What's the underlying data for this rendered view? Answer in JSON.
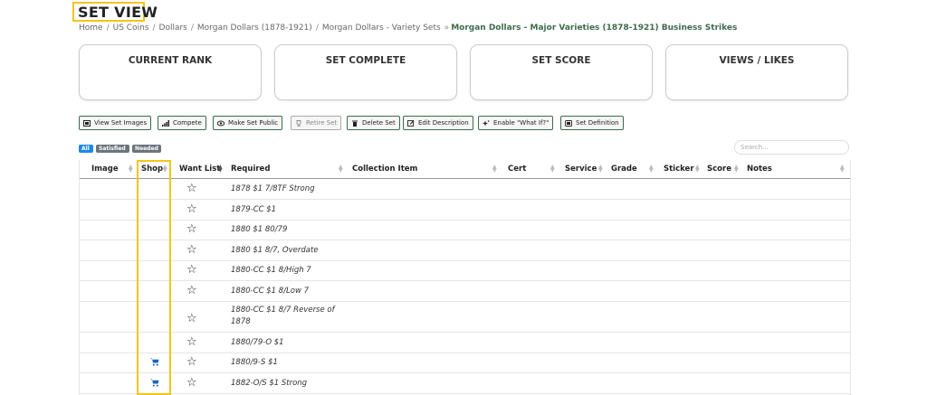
{
  "page": {
    "title": "SET VIEW",
    "breadcrumb": [
      "Home",
      "US Coins",
      "Dollars",
      "Morgan Dollars (1878-1921)",
      "Morgan Dollars - Variety Sets"
    ],
    "breadcrumb_current": "Morgan Dollars - Major Varieties (1878-1921) Business Strikes",
    "breadcrumb_sep": "/",
    "breadcrumb_last_sep": "»"
  },
  "cards": [
    {
      "label": "CURRENT RANK"
    },
    {
      "label": "SET COMPLETE"
    },
    {
      "label": "SET SCORE"
    },
    {
      "label": "VIEWS / LIKES"
    }
  ],
  "toolbar": {
    "buttons": [
      {
        "label": "View Set Images",
        "icon": "image-icon",
        "disabled": false
      },
      {
        "label": "Compete",
        "icon": "bar-chart-icon",
        "disabled": false
      },
      {
        "label": "Make Set Public",
        "icon": "eye-icon",
        "disabled": false
      },
      {
        "label": "Retire Set",
        "icon": "trophy-icon",
        "disabled": true
      },
      {
        "label": "Delete Set",
        "icon": "trash-icon",
        "disabled": false
      },
      {
        "label": "Edit Description",
        "icon": "edit-icon",
        "disabled": false
      },
      {
        "label": "Enable \"What If?\"",
        "icon": "sparkle-icon",
        "disabled": false
      },
      {
        "label": "Set Definition",
        "icon": "definition-icon",
        "disabled": false
      }
    ]
  },
  "filters": [
    {
      "label": "All",
      "color": "#1e88e5"
    },
    {
      "label": "Satisfied",
      "color": "#6c757d"
    },
    {
      "label": "Needed",
      "color": "#6c757d"
    }
  ],
  "search": {
    "placeholder": "Search..."
  },
  "table": {
    "columns": [
      "Image",
      "Shop",
      "Want List",
      "Required",
      "Collection Item",
      "Cert",
      "Service",
      "Grade",
      "Sticker",
      "Score",
      "Notes"
    ],
    "rows": [
      {
        "required": "1878 $1 7/8TF Strong",
        "shop": false
      },
      {
        "required": "1879-CC $1",
        "shop": false
      },
      {
        "required": "1880 $1 80/79",
        "shop": false
      },
      {
        "required": "1880 $1 8/7, Overdate",
        "shop": false
      },
      {
        "required": "1880-CC $1 8/High 7",
        "shop": false
      },
      {
        "required": "1880-CC $1 8/Low 7",
        "shop": false
      },
      {
        "required": "1880-CC $1 8/7 Reverse of 1878",
        "shop": false
      },
      {
        "required": "1880/79-O $1",
        "shop": false
      },
      {
        "required": "1880/9-S $1",
        "shop": true
      },
      {
        "required": "1882-O/S $1 Strong",
        "shop": true
      }
    ]
  },
  "colors": {
    "highlight": "#f5c518",
    "accent_green": "#3c6b4d",
    "cart_blue": "#1565c0"
  }
}
